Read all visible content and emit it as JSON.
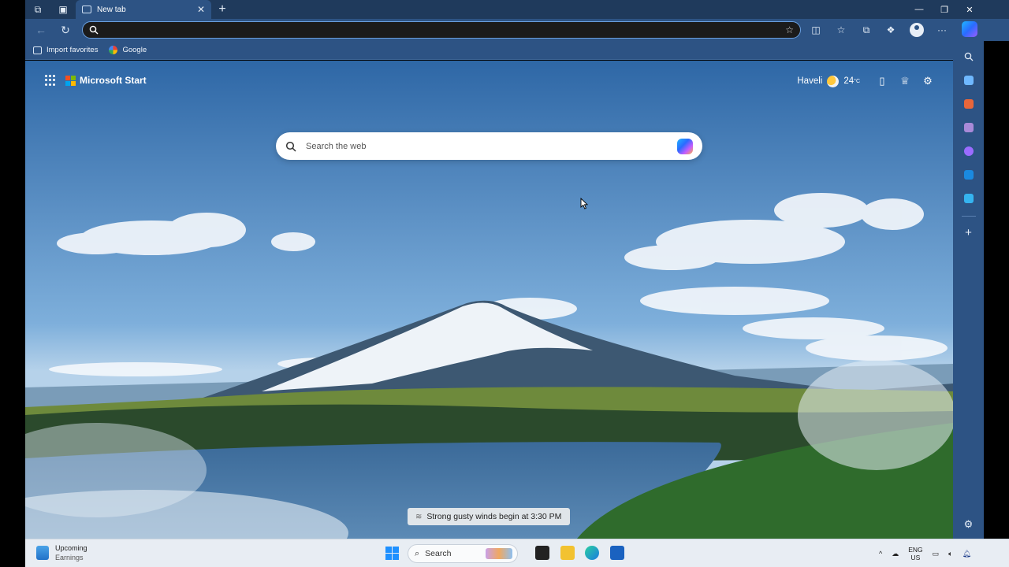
{
  "browser": {
    "tab_title": "New tab",
    "address_value": "",
    "favorites": [
      {
        "label": "Import favorites",
        "icon": "import-icon"
      },
      {
        "label": "Google",
        "icon": "google-icon"
      }
    ]
  },
  "page": {
    "brand": "Microsoft Start",
    "location": "Haveli",
    "temperature": "24",
    "temperature_unit": "°C",
    "search_placeholder": "Search the web",
    "weather_alert": "Strong gusty winds begin at 3:30 PM"
  },
  "taskbar": {
    "widget_title": "Upcoming",
    "widget_subtitle": "Earnings",
    "search_label": "Search",
    "lang_top": "ENG",
    "lang_bottom": "US"
  },
  "colors": {
    "titlebar": "#1f3a5c",
    "toolbar": "#2d5384",
    "taskbar": "#e8edf3"
  }
}
